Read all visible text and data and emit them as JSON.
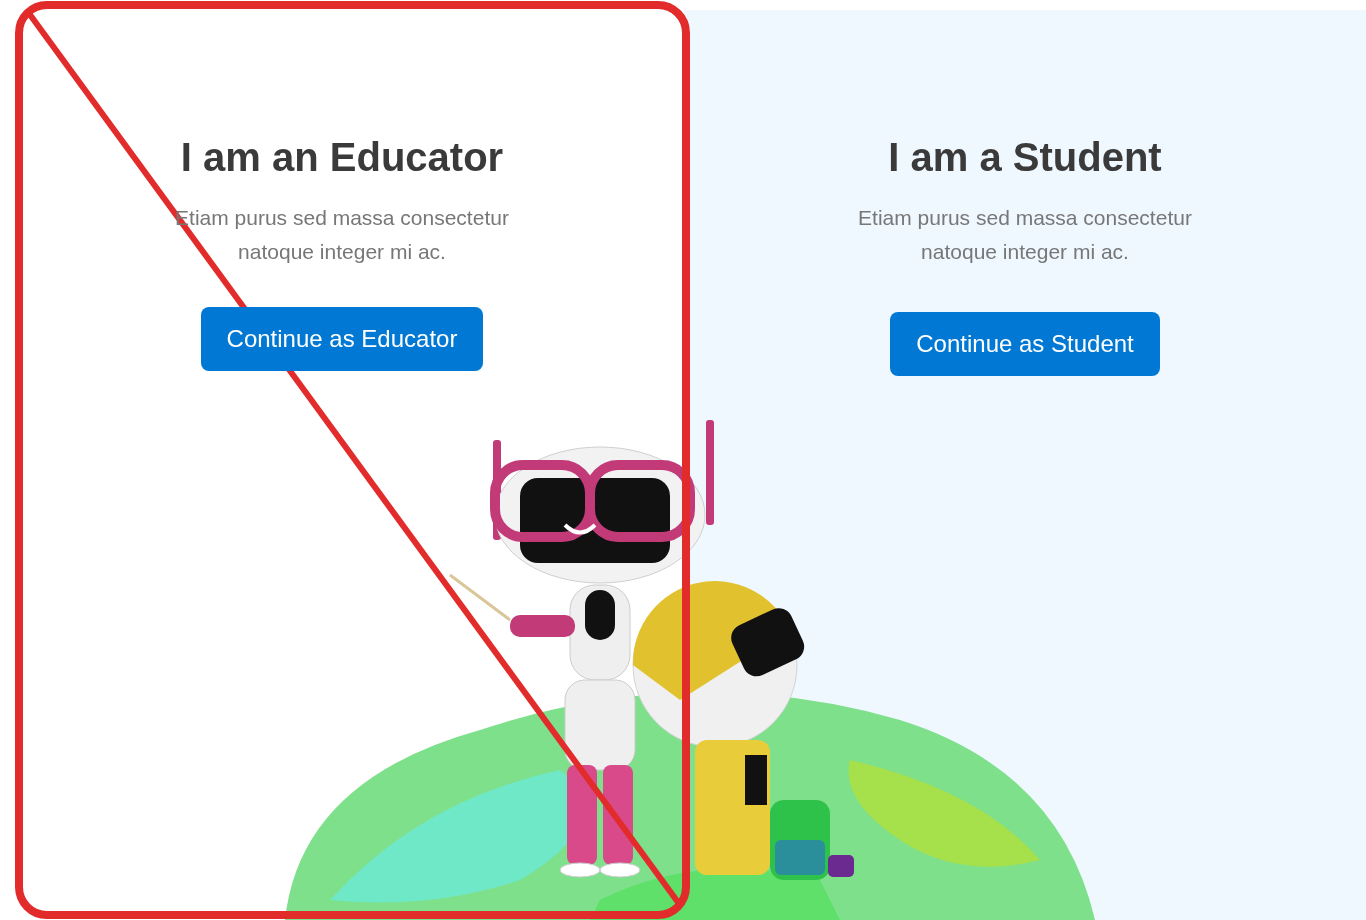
{
  "cards": [
    {
      "title": "I am an Educator",
      "description": "Etiam purus sed massa consectetur natoque integer mi ac.",
      "button": "Continue as Educator",
      "crossed_out": true
    },
    {
      "title": "I am a Student",
      "description": "Etiam purus sed massa consectetur natoque integer mi ac.",
      "button": "Continue as Student",
      "crossed_out": false
    }
  ]
}
